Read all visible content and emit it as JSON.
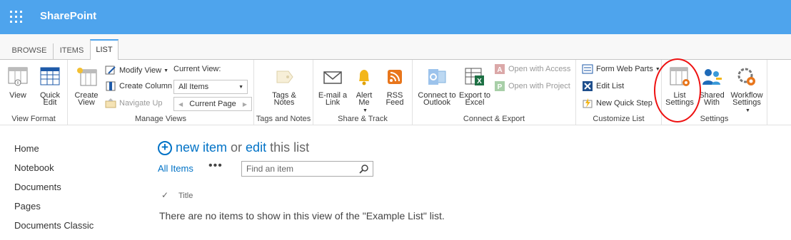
{
  "suite": {
    "brand": "SharePoint"
  },
  "tabs": [
    "BROWSE",
    "ITEMS",
    "LIST"
  ],
  "ribbon": {
    "view_format": {
      "label": "View Format",
      "view": "View",
      "quick_edit_1": "Quick",
      "quick_edit_2": "Edit"
    },
    "manage_views": {
      "label": "Manage Views",
      "create_view_1": "Create",
      "create_view_2": "View",
      "modify_view": "Modify View",
      "create_column": "Create Column",
      "navigate_up": "Navigate Up",
      "current_view_label": "Current View:",
      "current_view_value": "All Items",
      "current_page": "Current Page"
    },
    "tags_notes": {
      "label": "Tags and Notes",
      "tags_1": "Tags &",
      "tags_2": "Notes"
    },
    "share_track": {
      "label": "Share & Track",
      "email_1": "E-mail a",
      "email_2": "Link",
      "alert_1": "Alert",
      "alert_2": "Me",
      "rss_1": "RSS",
      "rss_2": "Feed"
    },
    "connect_export": {
      "label": "Connect & Export",
      "outlook_1": "Connect to",
      "outlook_2": "Outlook",
      "excel_1": "Export to",
      "excel_2": "Excel",
      "open_access": "Open with Access",
      "open_project": "Open with Project"
    },
    "customize_list": {
      "label": "Customize List",
      "form_web_parts": "Form Web Parts",
      "edit_list": "Edit List",
      "new_quick_step": "New Quick Step"
    },
    "settings": {
      "label": "Settings",
      "list_settings_1": "List",
      "list_settings_2": "Settings",
      "shared_with_1": "Shared",
      "shared_with_2": "With",
      "workflow_1": "Workflow",
      "workflow_2": "Settings"
    }
  },
  "leftnav": [
    "Home",
    "Notebook",
    "Documents",
    "Pages",
    "Documents Classic"
  ],
  "main": {
    "new_item": "new item",
    "or": "or",
    "edit": "edit",
    "this_list": "this list",
    "view_name": "All Items",
    "more": "•••",
    "search_placeholder": "Find an item",
    "check": "✓",
    "column_title": "Title",
    "empty_message": "There are no items to show in this view of the \"Example List\" list."
  },
  "colors": {
    "suite": "#4ea4ed",
    "link": "#0072c6",
    "callout": "#ee1111"
  }
}
